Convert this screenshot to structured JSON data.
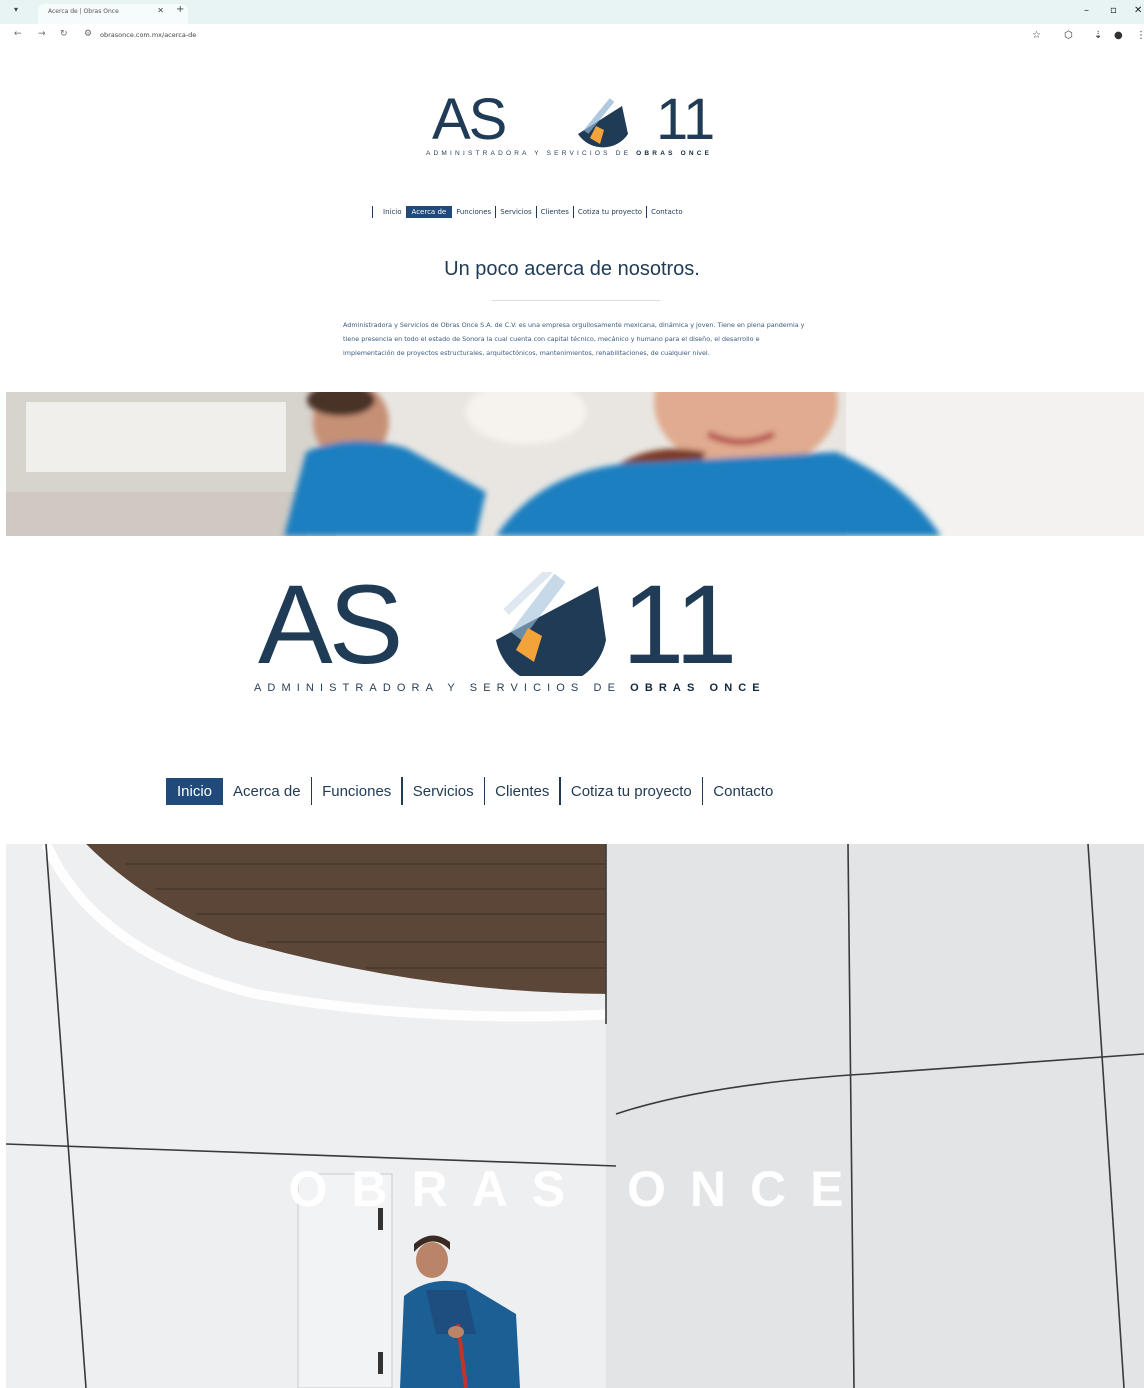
{
  "browser": {
    "tab_title": "Acerca de | Obras Once",
    "url": "obrasonce.com.mx/acerca-de"
  },
  "logo": {
    "mark": "AS",
    "number": "11",
    "tagline_light": "ADMINISTRADORA Y SERVICIOS DE",
    "tagline_bold": "OBRAS ONCE"
  },
  "nav": {
    "items": [
      "Inicio",
      "Acerca de",
      "Funciones",
      "Servicios",
      "Clientes",
      "Cotiza tu proyecto",
      "Contacto"
    ],
    "top_active": "Acerca de",
    "bottom_active": "Inicio"
  },
  "about": {
    "title": "Un poco acerca de nosotros.",
    "body": "Administradora y Servicios de Obras Once S.A. de C.V. es una empresa orgullosamente mexicana, dinámica y joven. Tiene en plena pandemia y tiene presencia en todo el estado de Sonora la cual cuenta con capital técnico, mecánico y humano para el diseño, el desarrollo e implementación de proyectos estructurales, arquitectónicos, mantenimientos, rehabilitaciones, de cualquier nivel."
  },
  "hero": {
    "word": "OBRAS ONCE"
  },
  "colors": {
    "brand_navy": "#1f3b55",
    "nav_active": "#1f4a7a",
    "accent_orange": "#f2a33a"
  }
}
